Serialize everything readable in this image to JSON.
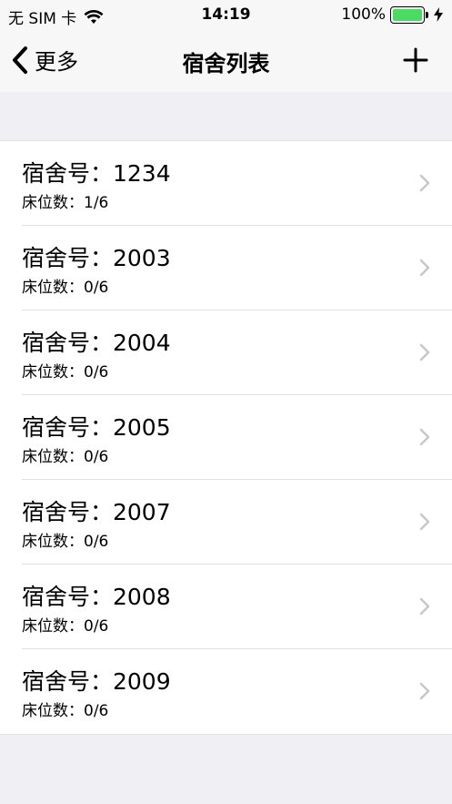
{
  "status_bar": {
    "carrier": "无 SIM 卡",
    "time": "14:19",
    "battery_percent": "100%",
    "battery_level": 1.0,
    "battery_color": "#4cd964"
  },
  "nav": {
    "back_label": "更多",
    "title": "宿舍列表",
    "add_icon": "plus-icon"
  },
  "dorms": [
    {
      "title": "宿舍号：1234",
      "beds": "床位数：1/6"
    },
    {
      "title": "宿舍号：2003",
      "beds": "床位数：0/6"
    },
    {
      "title": "宿舍号：2004",
      "beds": "床位数：0/6"
    },
    {
      "title": "宿舍号：2005",
      "beds": "床位数：0/6"
    },
    {
      "title": "宿舍号：2007",
      "beds": "床位数：0/6"
    },
    {
      "title": "宿舍号：2008",
      "beds": "床位数：0/6"
    },
    {
      "title": "宿舍号：2009",
      "beds": "床位数：0/6"
    }
  ]
}
